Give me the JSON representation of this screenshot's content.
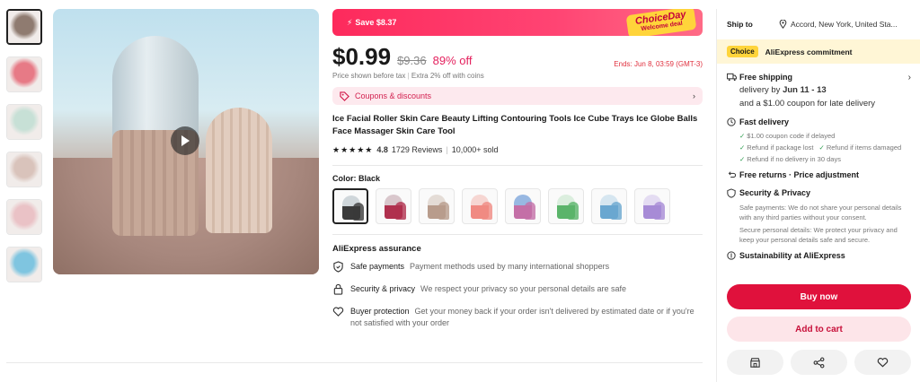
{
  "thumbnails": [
    {
      "color": "#8f7b70"
    },
    {
      "color": "#e77a86"
    },
    {
      "color": "#c7e0d6"
    },
    {
      "color": "#d9c3bb"
    },
    {
      "color": "#eac2c6"
    },
    {
      "color": "#7fc5e0"
    }
  ],
  "promo": {
    "save_text": "Save $8.37",
    "badge_line1": "ChoiceDay",
    "badge_line2": "Welcome deal"
  },
  "price": {
    "current": "$0.99",
    "original": "$9.36",
    "discount": "89% off",
    "ends": "Ends: Jun 8, 03:59 (GMT-3)",
    "tax_note": "Price shown before tax",
    "extra": "Extra 2% off with coins"
  },
  "coupons": {
    "label": "Coupons & discounts"
  },
  "product": {
    "title": "Ice Facial Roller Skin Care Beauty Lifting Contouring Tools Ice Cube Trays Ice Globe Balls Face Massager Skin Care Tool",
    "rating": "4.8",
    "reviews": "1729 Reviews",
    "sold": "10,000+ sold"
  },
  "color": {
    "label": "Color: Black",
    "swatches": [
      {
        "name": "Black",
        "color": "#3a3a3a",
        "cap": "#cfd6da"
      },
      {
        "name": "Wine",
        "color": "#b0304e",
        "cap": "#d9c7cc"
      },
      {
        "name": "Khaki",
        "color": "#b89c8c",
        "cap": "#e4dcd6"
      },
      {
        "name": "Pink",
        "color": "#f08a82",
        "cap": "#f6d6d2"
      },
      {
        "name": "Multi",
        "color": "#c46fa7",
        "cap": "#98b8e2"
      },
      {
        "name": "Green",
        "color": "#5ab46a",
        "cap": "#dbeede"
      },
      {
        "name": "Blue",
        "color": "#6aa7d0",
        "cap": "#d6e6f0"
      },
      {
        "name": "Purple",
        "color": "#a78bd6",
        "cap": "#e4dcf2"
      }
    ]
  },
  "assurance": {
    "title": "AliExpress assurance",
    "items": [
      {
        "title": "Safe payments",
        "desc": "Payment methods used by many international shoppers"
      },
      {
        "title": "Security & privacy",
        "desc": "We respect your privacy so your personal details are safe"
      },
      {
        "title": "Buyer protection",
        "desc": "Get your money back if your order isn't delivered by estimated date or if you're not satisfied with your order"
      }
    ]
  },
  "sidebar": {
    "ship_label": "Ship to",
    "location": "Accord, New York, United Sta...",
    "choice_tag": "Choice",
    "commitment": "AliExpress commitment",
    "free_shipping": "Free shipping",
    "delivery_prefix": "delivery by",
    "delivery_dates": "Jun 11 - 13",
    "late_coupon": "and a $1.00 coupon for late delivery",
    "fast_delivery": "Fast delivery",
    "fast_items": [
      "$1.00 coupon code if delayed",
      "Refund if package lost",
      "Refund if items damaged",
      "Refund if no delivery in 30 days"
    ],
    "free_returns": "Free returns · Price adjustment",
    "security_title": "Security & Privacy",
    "security_text1": "Safe payments: We do not share your personal details with any third parties without your consent.",
    "security_text2": "Secure personal details: We protect your privacy and keep your personal details safe and secure.",
    "sustainability": "Sustainability at AliExpress",
    "buy_now": "Buy now",
    "add_to_cart": "Add to cart"
  },
  "colors": {
    "accent": "#e0113c",
    "promo": "#fd2a5c",
    "choice_yellow": "#ffd43a"
  }
}
